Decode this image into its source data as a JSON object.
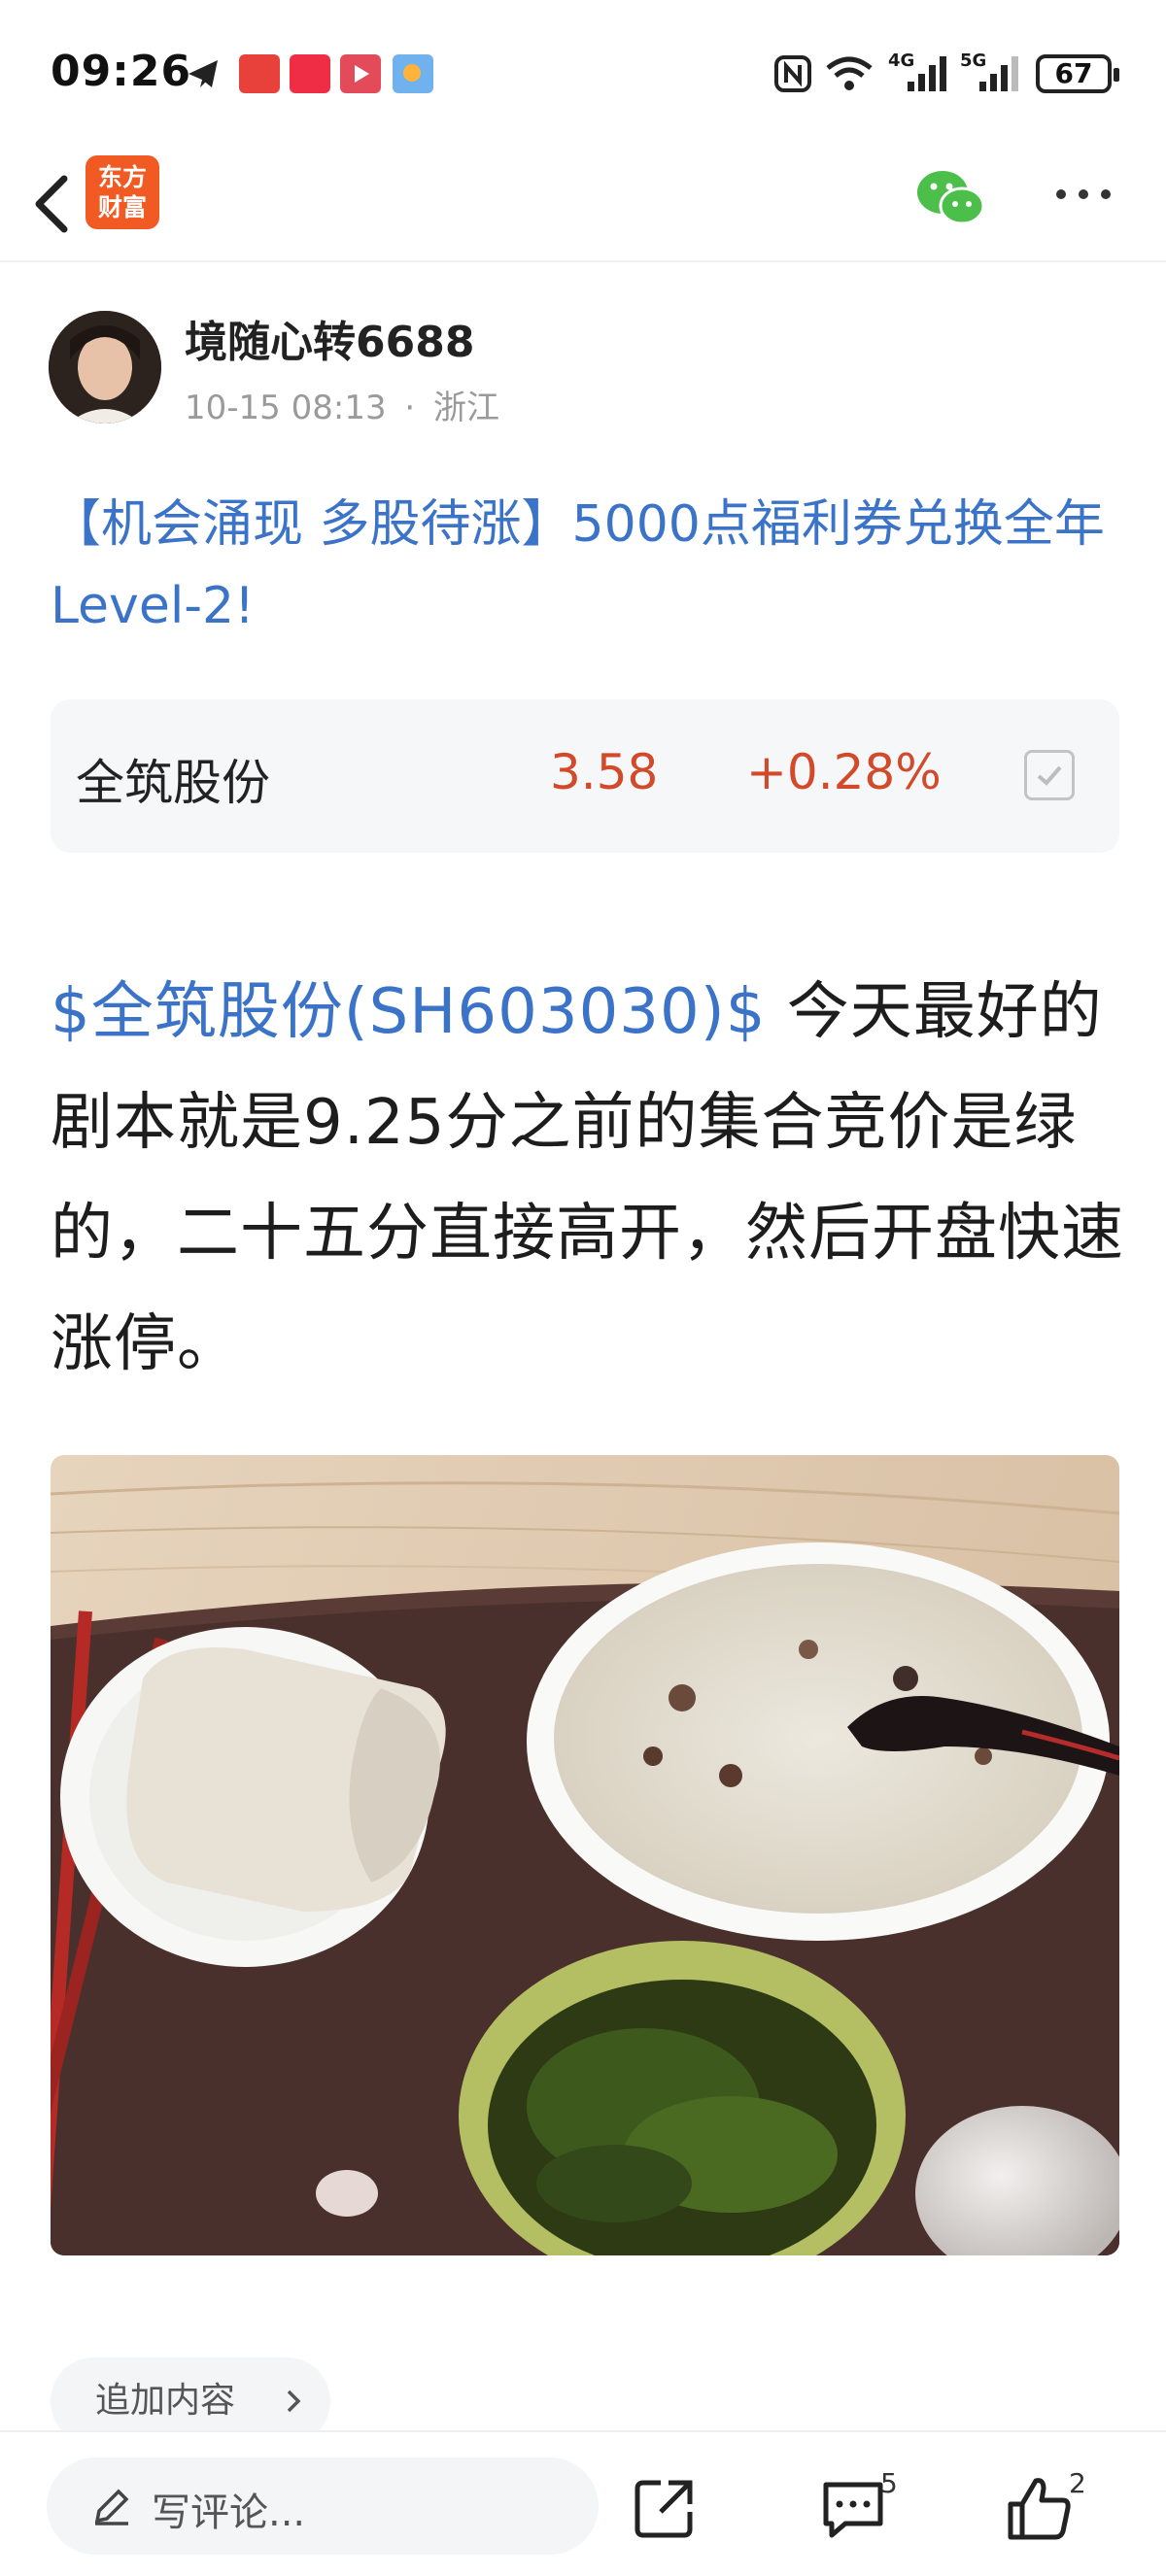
{
  "status_bar": {
    "time": "09:26",
    "notifications": [
      "telegram-icon",
      "toutiao-icon",
      "xiaohongshu-icon",
      "video-icon",
      "weather-icon"
    ],
    "signal_labels": [
      "4G",
      "5G"
    ],
    "battery": "67"
  },
  "header": {
    "back_icon": "back-arrow-icon",
    "logo_line1": "东方",
    "logo_line2": "财富",
    "share_icon": "wechat-icon",
    "more_icon": "more-dots-icon"
  },
  "post": {
    "author": "境随心转6688",
    "time": "10-15 08:13",
    "separator": "·",
    "location": "浙江",
    "title": "【机会涌现 多股待涨】5000点福利券兑换全年Level-2!",
    "stock": {
      "name": "全筑股份",
      "price": "3.58",
      "change": "+0.28%"
    },
    "body_link": "$全筑股份(SH603030)$",
    "body_text": " 今天最好的剧本就是9.25分之前的集合竞价是绿的，二十五分直接高开，然后开盘快速涨停。",
    "add_content_label": "追加内容"
  },
  "bottom_bar": {
    "comment_placeholder": "写评论...",
    "comment_count": "5",
    "like_count": "2"
  },
  "colors": {
    "link_blue": "#3a73c8",
    "price_red": "#d24a2a",
    "brand_orange": "#f15a22",
    "wechat_green": "#4cbf4a"
  }
}
